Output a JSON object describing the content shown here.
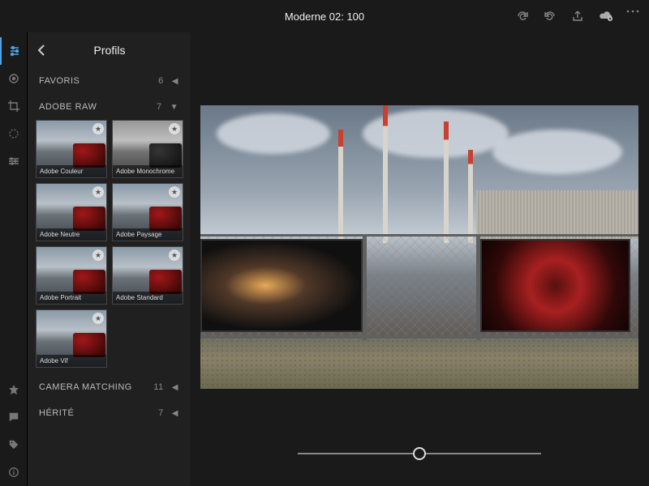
{
  "header": {
    "title": "Moderne 02: 100"
  },
  "sidebar": {
    "title": "Profils",
    "categories": [
      {
        "name": "FAVORIS",
        "count": 6,
        "expanded": false
      },
      {
        "name": "ADOBE RAW",
        "count": 7,
        "expanded": true
      },
      {
        "name": "CAMERA MATCHING",
        "count": 11,
        "expanded": false
      },
      {
        "name": "HÉRITÉ",
        "count": 7,
        "expanded": false
      }
    ],
    "adobe_raw_profiles": [
      {
        "label": "Adobe Couleur",
        "favorite": true,
        "mono": false
      },
      {
        "label": "Adobe Monochrome",
        "favorite": true,
        "mono": true
      },
      {
        "label": "Adobe Neutre",
        "favorite": true,
        "mono": false
      },
      {
        "label": "Adobe Paysage",
        "favorite": true,
        "mono": false
      },
      {
        "label": "Adobe Portrait",
        "favorite": true,
        "mono": false
      },
      {
        "label": "Adobe Standard",
        "favorite": true,
        "mono": false
      },
      {
        "label": "Adobe Vif",
        "favorite": true,
        "mono": false
      }
    ]
  },
  "slider": {
    "value": 100,
    "min": 0,
    "max": 200
  },
  "icons": {
    "redo": "redo-icon",
    "undo": "undo-icon",
    "share": "share-icon",
    "cloud": "cloud-sync-icon",
    "more": "more-icon"
  }
}
